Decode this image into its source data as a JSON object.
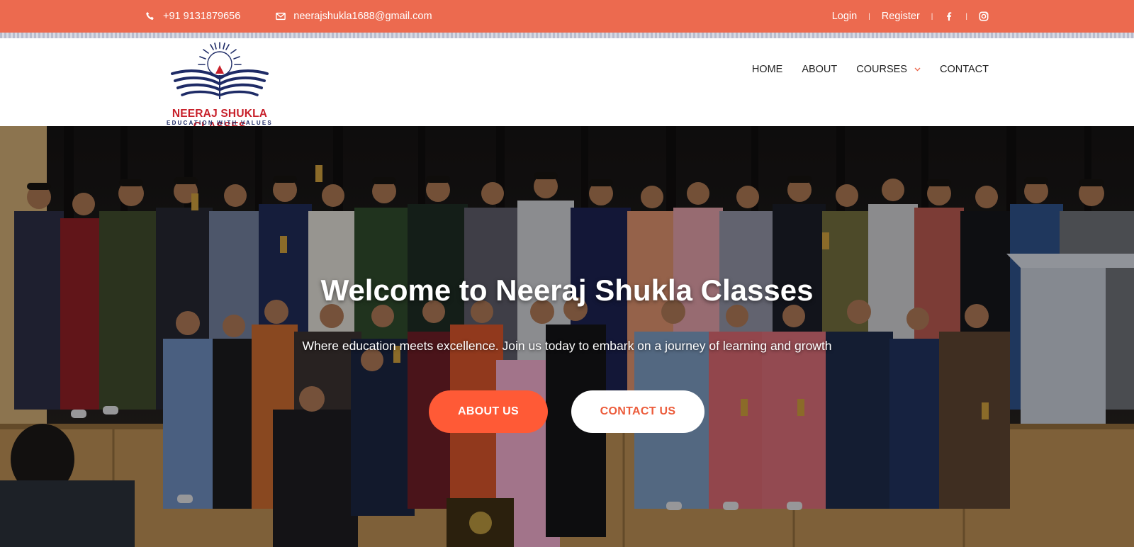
{
  "topbar": {
    "phone_icon": "phone-icon",
    "phone": "+91 9131879656",
    "email_icon": "envelope-icon",
    "email": "neerajshukla1688@gmail.com",
    "login": "Login",
    "separator": "|",
    "register": "Register",
    "facebook_icon": "facebook-icon",
    "instagram_icon": "instagram-icon",
    "bg_color": "#ec6a4f"
  },
  "logo": {
    "name": "NEERAJ SHUKLA CLASSES",
    "tagline": "EDUCATION WITH VALUES"
  },
  "nav": {
    "items": [
      {
        "label": "HOME"
      },
      {
        "label": "ABOUT"
      },
      {
        "label": "COURSES",
        "has_dropdown": true
      },
      {
        "label": "CONTACT"
      }
    ],
    "dropdown_icon": "chevron-down-icon"
  },
  "hero": {
    "title": "Welcome to Neeraj Shukla Classes",
    "subtitle": "Where education meets excellence. Join us today to embark on a journey of learning and growth",
    "primary_button": "ABOUT US",
    "secondary_button": "CONTACT US",
    "accent_color": "#ff5a36"
  }
}
